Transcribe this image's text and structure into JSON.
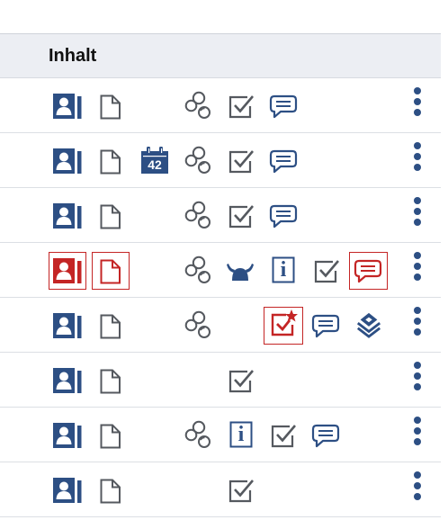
{
  "header": {
    "title": "Inhalt"
  },
  "calendar_badge": "42",
  "info_glyph": "i",
  "colors": {
    "icon_blue": "#2d4f84",
    "icon_gray": "#55595f",
    "alert_red": "#c42525",
    "header_bg": "#eceef3"
  },
  "rows": [
    {
      "icons": [
        "contact-card-icon",
        "document-icon",
        "bubbles-icon",
        "checkbox-icon",
        "comment-icon"
      ],
      "menu": "more-vertical-icon"
    },
    {
      "icons": [
        "contact-card-icon",
        "document-icon",
        "calendar-icon",
        "bubbles-icon",
        "checkbox-icon",
        "comment-icon"
      ],
      "menu": "more-vertical-icon"
    },
    {
      "icons": [
        "contact-card-icon",
        "document-icon",
        "bubbles-icon",
        "checkbox-icon",
        "comment-icon"
      ],
      "menu": "more-vertical-icon"
    },
    {
      "icons": [
        "contact-card-icon",
        "document-icon",
        "bubbles-icon",
        "viking-helmet-icon",
        "info-icon",
        "checkbox-icon",
        "comment-icon"
      ],
      "highlighted": [
        "contact-card-icon",
        "document-icon",
        "comment-icon"
      ],
      "menu": "more-vertical-icon"
    },
    {
      "icons": [
        "contact-card-icon",
        "document-icon",
        "bubbles-icon",
        "starred-checkbox-icon",
        "comment-icon",
        "layers-icon"
      ],
      "highlighted": [
        "starred-checkbox-icon"
      ],
      "menu": "more-vertical-icon"
    },
    {
      "icons": [
        "contact-card-icon",
        "document-icon",
        "checkbox-icon"
      ],
      "menu": "more-vertical-icon"
    },
    {
      "icons": [
        "contact-card-icon",
        "document-icon",
        "bubbles-icon",
        "info-icon",
        "checkbox-icon",
        "comment-icon"
      ],
      "menu": "more-vertical-icon"
    },
    {
      "icons": [
        "contact-card-icon",
        "document-icon",
        "checkbox-icon"
      ],
      "menu": "more-vertical-icon"
    }
  ]
}
